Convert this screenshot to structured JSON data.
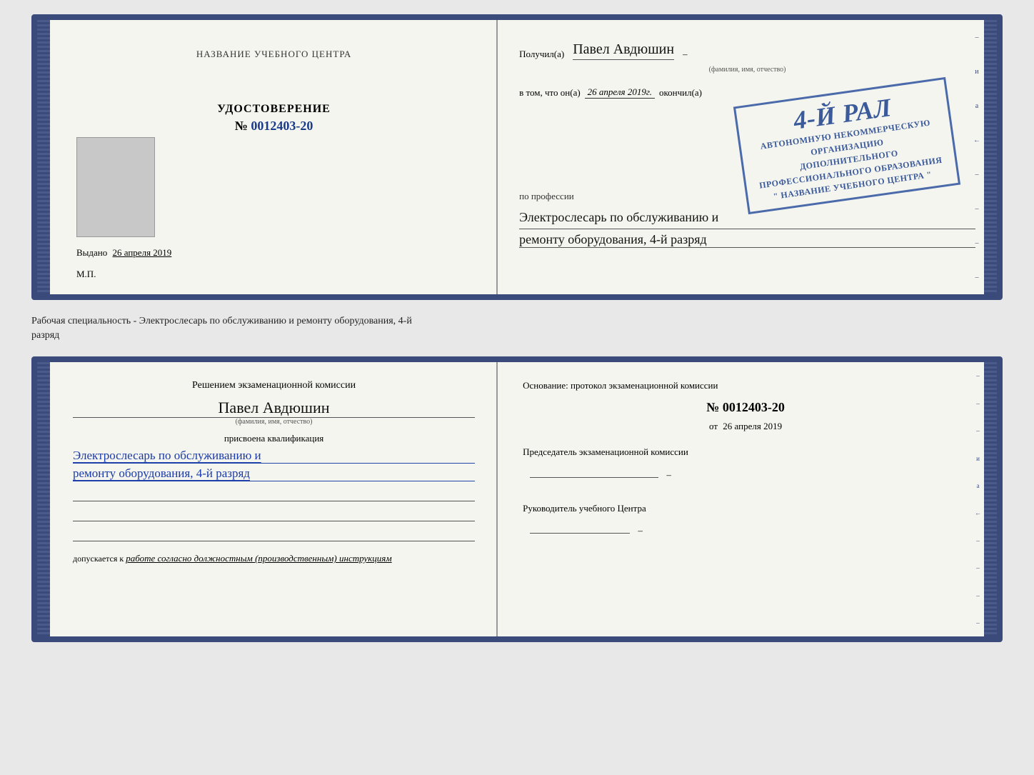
{
  "doc1": {
    "left": {
      "training_center_label": "НАЗВАНИЕ УЧЕБНОГО ЦЕНТРА",
      "cert_type": "УДОСТОВЕРЕНИЕ",
      "cert_number_prefix": "№",
      "cert_number": "0012403-20",
      "issued_label": "Выдано",
      "issued_date": "26 апреля 2019",
      "mp_label": "М.П."
    },
    "right": {
      "received_label": "Получил(а)",
      "person_name": "Павел Авдюшин",
      "fio_label": "(фамилия, имя, отчество)",
      "vtom_label": "в том, что он(а)",
      "completed_date": "26 апреля 2019г.",
      "completed_label": "окончил(а)",
      "stamp_line1": "АВТОНОМНУЮ НЕКОММЕРЧЕСКУЮ ОРГАНИЗАЦИЮ",
      "stamp_line2": "ДОПОЛНИТЕЛЬНОГО ПРОФЕССИОНАЛЬНОГО ОБРАЗОВАНИЯ",
      "stamp_line3": "\" НАЗВАНИЕ УЧЕБНОГО ЦЕНТРА \"",
      "stamp_big": "4-й рал",
      "profession_label": "по профессии",
      "profession_line1": "Электрослесарь по обслуживанию и",
      "profession_line2": "ремонту оборудования, 4-й разряд"
    }
  },
  "separator": {
    "text_line1": "Рабочая специальность - Электрослесарь по обслуживанию и ремонту оборудования, 4-й",
    "text_line2": "разряд"
  },
  "doc2": {
    "left": {
      "komissia_text": "Решением экзаменационной комиссии",
      "person_name": "Павел Авдюшин",
      "fio_label": "(фамилия, имя, отчество)",
      "qualification_prefix": "присвоена квалификация",
      "qualification_line1": "Электрослесарь по обслуживанию и",
      "qualification_line2": "ремонту оборудования, 4-й разряд",
      "dopusk_prefix": "допускается к",
      "dopusk_text": "работе согласно должностным (производственным) инструкциям"
    },
    "right": {
      "osnovanie_text": "Основание: протокол экзаменационной комиссии",
      "number_prefix": "№",
      "protocol_number": "0012403-20",
      "from_prefix": "от",
      "from_date": "26 апреля 2019",
      "chairman_label": "Председатель экзаменационной комиссии",
      "director_label": "Руководитель учебного Центра"
    }
  },
  "edge_marks": {
    "marks": [
      "–",
      "и",
      "а",
      "←",
      "–",
      "–",
      "–",
      "–"
    ]
  }
}
